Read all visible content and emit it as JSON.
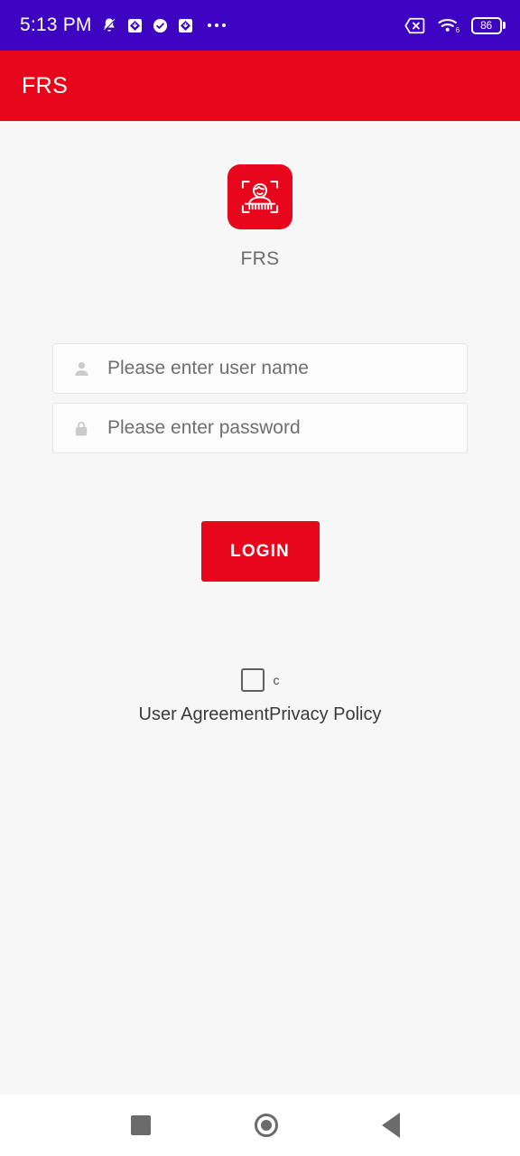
{
  "status_bar": {
    "time": "5:13 PM",
    "icons": [
      "bell-muted-icon",
      "diamond-arrow-icon",
      "check-circle-icon",
      "diamond-arrow-icon",
      "more-dots-icon"
    ],
    "right_icons": [
      "no-sim-icon",
      "wifi-6-icon"
    ],
    "battery_level": "86",
    "background_color": "#3d05c2"
  },
  "app_bar": {
    "title": "FRS",
    "background_color": "#e8061c",
    "text_color": "#ffffff"
  },
  "branding": {
    "logo_icon": "face-recognition-icon",
    "logo_background_color": "#e8061c",
    "caption": "FRS"
  },
  "form": {
    "username": {
      "icon": "person-icon",
      "placeholder": "Please enter user name",
      "value": ""
    },
    "password": {
      "icon": "lock-icon",
      "placeholder": "Please enter password",
      "value": ""
    },
    "login_label": "LOGIN",
    "login_color": "#e8061c"
  },
  "agreement": {
    "checked": false,
    "inline_label": "c",
    "user_agreement_label": "User Agreement",
    "privacy_policy_label": "Privacy Policy"
  },
  "nav_bar": {
    "recents": "recents-square-icon",
    "home": "home-circle-icon",
    "back": "back-triangle-icon"
  }
}
